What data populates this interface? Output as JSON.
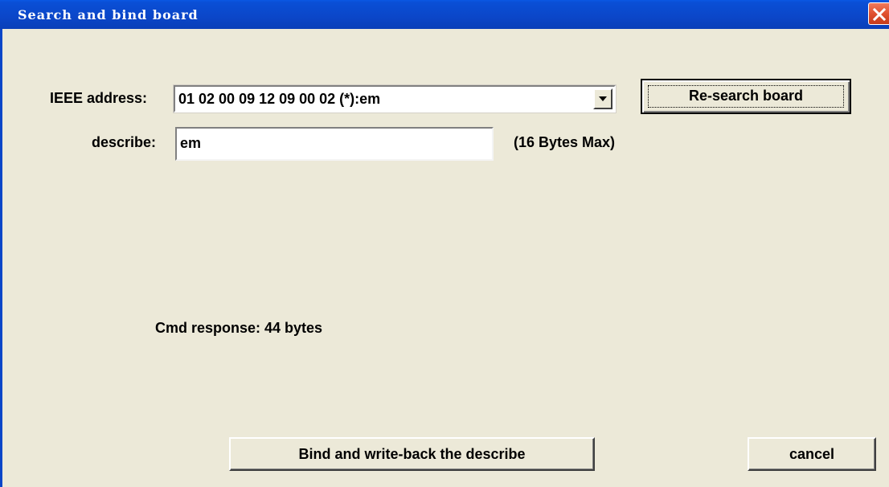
{
  "window": {
    "title": "Search and bind board"
  },
  "form": {
    "ieee_label": "IEEE address:",
    "ieee_value": "01 02 00 09 12 09 00 02 (*):em",
    "describe_label": "describe:",
    "describe_value": "em",
    "max_hint": "(16 Bytes Max)",
    "cmd_response": "Cmd response: 44 bytes"
  },
  "buttons": {
    "research_label": "Re-search board",
    "bind_label": "Bind and write-back the describe",
    "cancel_label": "cancel"
  },
  "icons": {
    "close": "close-icon",
    "dropdown": "chevron-down-icon"
  },
  "colors": {
    "titlebar": "#0a46c8",
    "close_button": "#e0502e",
    "dialog_background": "#ece9d8"
  }
}
